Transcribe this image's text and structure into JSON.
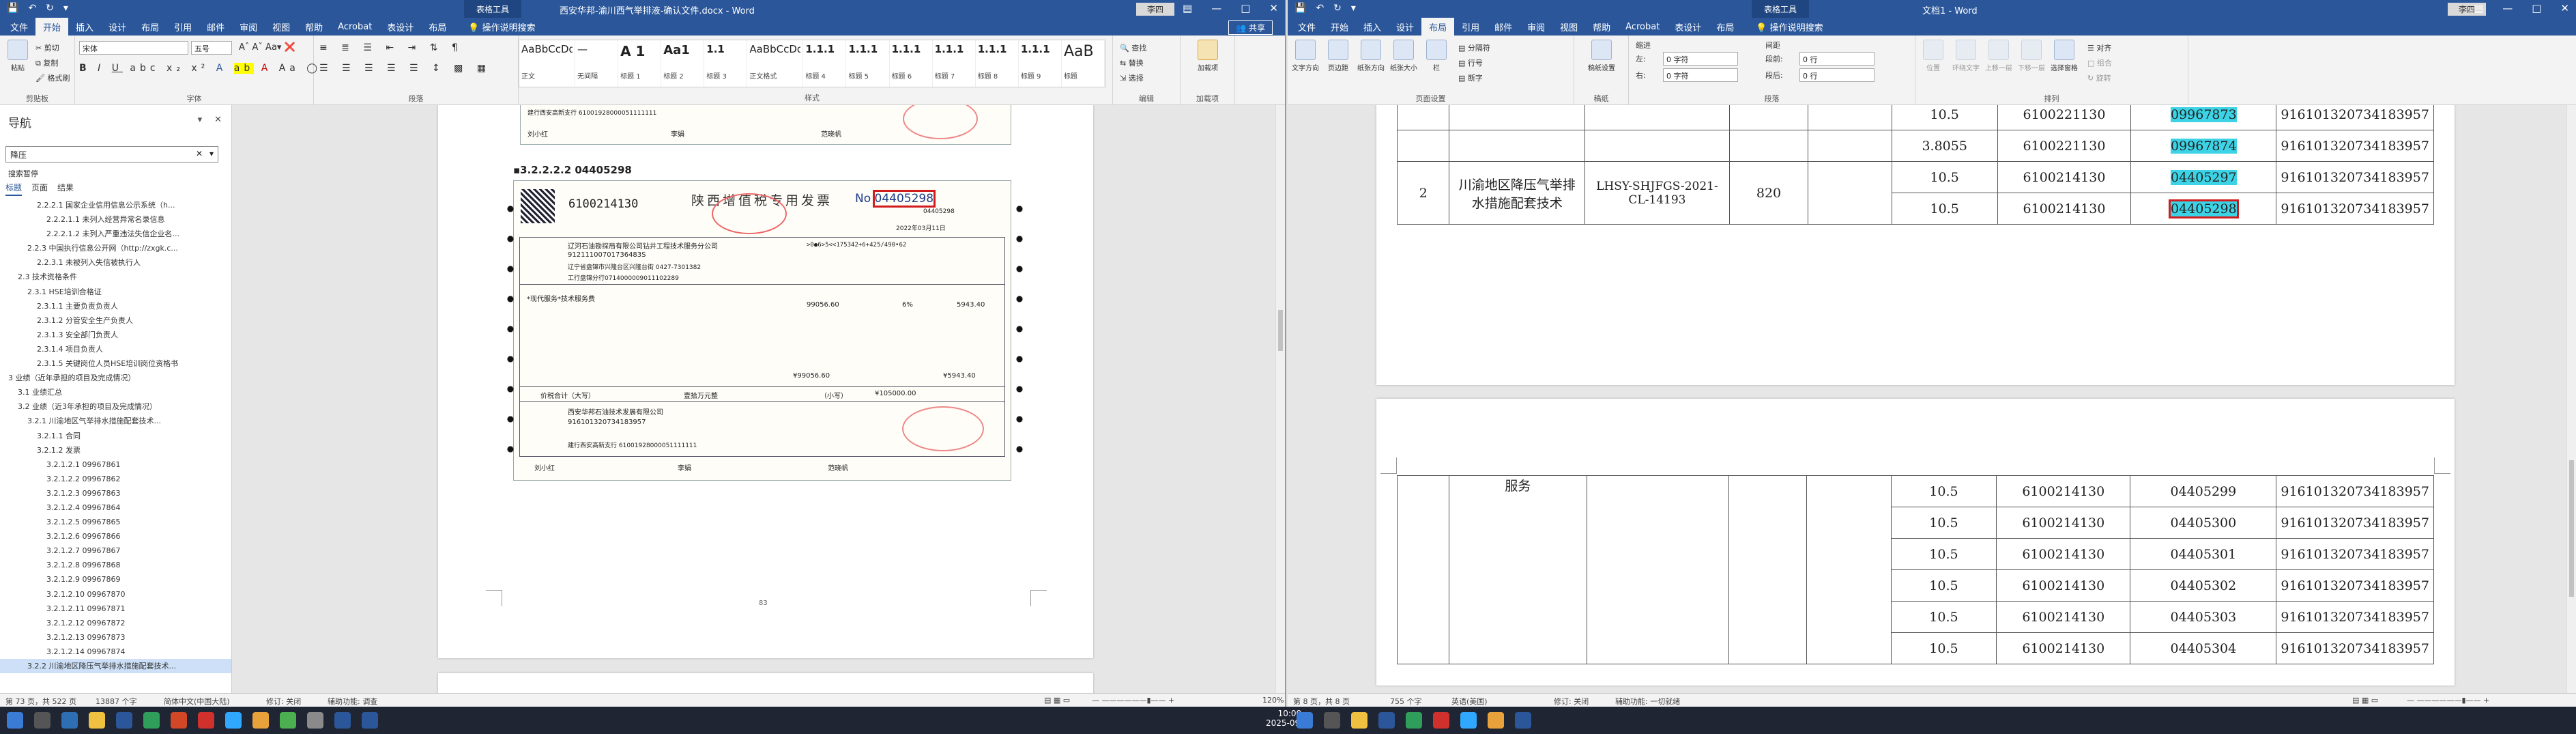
{
  "left": {
    "title": "西安华邦-渝川西气举排液-确认文件.docx - Word",
    "context_tab": "表格工具",
    "user": "李四",
    "tabs": [
      "文件",
      "开始",
      "插入",
      "设计",
      "布局",
      "引用",
      "邮件",
      "审阅",
      "视图",
      "帮助",
      "Acrobat",
      "表设计",
      "布局"
    ],
    "tell": "操作说明搜索",
    "share": "共享",
    "ribbon": {
      "paste": "粘贴",
      "cut": "剪切",
      "copy": "复制",
      "format_painter": "格式刷",
      "clipboard": "剪贴板",
      "font_name": "宋体",
      "font_size": "五号",
      "font": "字体",
      "paragraph": "段落",
      "styles_label": "样式",
      "styles": [
        {
          "preview": "AaBbCcDd",
          "name": "正文"
        },
        {
          "preview": "—",
          "name": "无间隔"
        },
        {
          "preview": "A 1",
          "name": "标题 1"
        },
        {
          "preview": "Aa1",
          "name": "标题 2"
        },
        {
          "preview": "1.1",
          "name": "标题 3"
        },
        {
          "preview": "AaBbCcDd",
          "name": "正文格式"
        },
        {
          "preview": "1.1.1",
          "name": "标题 4"
        },
        {
          "preview": "1.1.1",
          "name": "标题 5"
        },
        {
          "preview": "1.1.1",
          "name": "标题 6"
        },
        {
          "preview": "1.1.1",
          "name": "标题 7"
        },
        {
          "preview": "1.1.1",
          "name": "标题 8"
        },
        {
          "preview": "1.1.1",
          "name": "标题 9"
        },
        {
          "preview": "AaB",
          "name": "标题"
        }
      ],
      "find": "查找",
      "replace": "替换",
      "select": "选择",
      "editing": "编辑",
      "addin": "加载项",
      "addin_group": "加载项"
    },
    "nav": {
      "title": "导航",
      "search": "降压",
      "results": "搜索暂停",
      "tabs": [
        "标题",
        "页面",
        "结果"
      ],
      "items": [
        "2.2.2.1 国家企业信用信息公示系统（h...",
        "2.2.2.1.1 未列入经营异常名录信息",
        "2.2.2.1.2 未列入严重违法失信企业名...",
        "2.2.3 中国执行信息公开网（http://zxgk.c...",
        "2.2.3.1 未被列入失信被执行人",
        "2.3 技术资格条件",
        "2.3.1 HSE培训合格证",
        "2.3.1.1 主要负责负责人",
        "2.3.1.2 分管安全生产负责人",
        "2.3.1.3 安全部门负责人",
        "2.3.1.4 项目负责人",
        "2.3.1.5 关键岗位人员HSE培训岗位资格书",
        "3 业绩（近年承担的项目及完成情况）",
        "3.1 业绩汇总",
        "3.2 业绩（近3年承担的项目及完成情况）",
        "3.2.1 川渝地区气举排水措施配套技术...",
        "3.2.1.1 合同",
        "3.2.1.2 发票",
        "3.2.1.2.1 09967861",
        "3.2.1.2.2 09967862",
        "3.2.1.2.3 09967863",
        "3.2.1.2.4 09967864",
        "3.2.1.2.5 09967865",
        "3.2.1.2.6 09967866",
        "3.2.1.2.7 09967867",
        "3.2.1.2.8 09967868",
        "3.2.1.2.9 09967869",
        "3.2.1.2.10 09967870",
        "3.2.1.2.11 09967871",
        "3.2.1.2.12 09967872",
        "3.2.1.2.13 09967873",
        "3.2.1.2.14 09967874",
        "3.2.2 川渝地区降压气举排水措施配套技术..."
      ]
    },
    "doc": {
      "heading": "3.2.2.2.2 04405298",
      "inv_title": "陕西增值税专用发票",
      "inv_code": "6100214130",
      "inv_no_prefix": "No",
      "inv_no": "04405298",
      "inv_no_small": "04405298",
      "inv_date": "2022年03月11日",
      "buyer_name": "辽河石油勘探局有限公司钻井工程技术服务分公司",
      "buyer_tax": "91211100701736483S",
      "buyer_addr": "辽宁省盘锦市兴隆台区兴隆台街 0427-7301382",
      "buyer_bank": "工行盘锦分行0714000009011102289",
      "cipher": ">0●6>5<<175342+6+425/490•62",
      "item": "*现代服务*技术服务费",
      "amount": "99056.60",
      "tax_rate": "6%",
      "tax": "5943.40",
      "total_label": "价税合计（大写）",
      "total_cn": "壹拾万元整",
      "total_small_label": "（小写）",
      "total": "¥105000.00",
      "subtotal_amount": "¥99056.60",
      "subtotal_tax": "¥5943.40",
      "seller_name": "西安华邦石油技术发展有限公司",
      "seller_tax": "916101320734183957",
      "seller_bank": "建行西安高新支行 61001928000051111111",
      "payee": "刘小红",
      "reviewer": "李娟",
      "issuer": "范晓帆",
      "prev_payee": "刘小红",
      "prev_reviewer": "李娟",
      "prev_issuer": "范晓帆",
      "prev_bank": "建行西安高新支行 61001928000051111111",
      "page_num": "83"
    },
    "status": {
      "page": "第 73 页，共 522 页",
      "words": "13887 个字",
      "lang": "简体中文(中国大陆)",
      "track": "修订: 关闭",
      "a11y": "辅助功能: 调查",
      "zoom": "120%"
    }
  },
  "right": {
    "title": "文档1 - Word",
    "context_tab": "表格工具",
    "user": "李四",
    "tabs": [
      "文件",
      "开始",
      "插入",
      "设计",
      "布局",
      "引用",
      "邮件",
      "审阅",
      "视图",
      "帮助",
      "Acrobat",
      "表设计",
      "布局"
    ],
    "tell": "操作说明搜索",
    "ribbon": {
      "text_dir": "文字方向",
      "margins": "页边距",
      "orientation": "纸张方向",
      "size": "纸张大小",
      "columns": "栏",
      "breaks": "分隔符",
      "line_num": "行号",
      "hyphen": "断字",
      "page_setup": "页面设置",
      "draft": "稿纸设置",
      "draft_group": "稿纸",
      "indent": "缩进",
      "spacing": "间距",
      "left_lbl": "左:",
      "right_lbl": "右:",
      "before_lbl": "段前:",
      "after_lbl": "段后:",
      "left_val": "0 字符",
      "right_val": "0 字符",
      "before_val": "0 行",
      "after_val": "0 行",
      "paragraph": "段落",
      "position": "位置",
      "wrap": "环绕文字",
      "forward": "上移一层",
      "backward": "下移一层",
      "sel_pane": "选择窗格",
      "align": "对齐",
      "group": "组合",
      "rotate": "旋转",
      "arrange": "排列"
    },
    "table1": {
      "rows": [
        {
          "amt": "10.5",
          "code": "6100221130",
          "no": "09967873",
          "tax": "916101320734183957"
        },
        {
          "amt": "3.8055",
          "code": "6100221130",
          "no": "09967874",
          "tax": "916101320734183957"
        },
        {
          "amt": "10.5",
          "code": "6100214130",
          "no": "04405297",
          "tax": "916101320734183957"
        },
        {
          "amt": "10.5",
          "code": "6100214130",
          "no": "04405298",
          "tax": "916101320734183957"
        }
      ],
      "seq": "2",
      "project": "川渝地区降压气举排水措施配套技术",
      "contract": "LHSY-SHJFGS-2021-CL-14193",
      "contract_amt": "820"
    },
    "table2": {
      "service": "服务",
      "rows": [
        {
          "amt": "10.5",
          "code": "6100214130",
          "no": "04405299",
          "tax": "916101320734183957"
        },
        {
          "amt": "10.5",
          "code": "6100214130",
          "no": "04405300",
          "tax": "916101320734183957"
        },
        {
          "amt": "10.5",
          "code": "6100214130",
          "no": "04405301",
          "tax": "916101320734183957"
        },
        {
          "amt": "10.5",
          "code": "6100214130",
          "no": "04405302",
          "tax": "916101320734183957"
        },
        {
          "amt": "10.5",
          "code": "6100214130",
          "no": "04405303",
          "tax": "916101320734183957"
        },
        {
          "amt": "10.5",
          "code": "6100214130",
          "no": "04405304",
          "tax": "916101320734183957"
        }
      ]
    },
    "status": {
      "page": "第 8 页，共 8 页",
      "words": "755 个字",
      "lang": "英语(美国)",
      "track": "修订: 关闭",
      "a11y": "辅助功能: 一切就绪"
    }
  },
  "taskbar": {
    "time": "10:00",
    "date": "2025-09-05"
  },
  "colors": {
    "word_blue": "#2b579a",
    "highlight": "#3dd3e6",
    "mark_red": "#d01c1c"
  }
}
